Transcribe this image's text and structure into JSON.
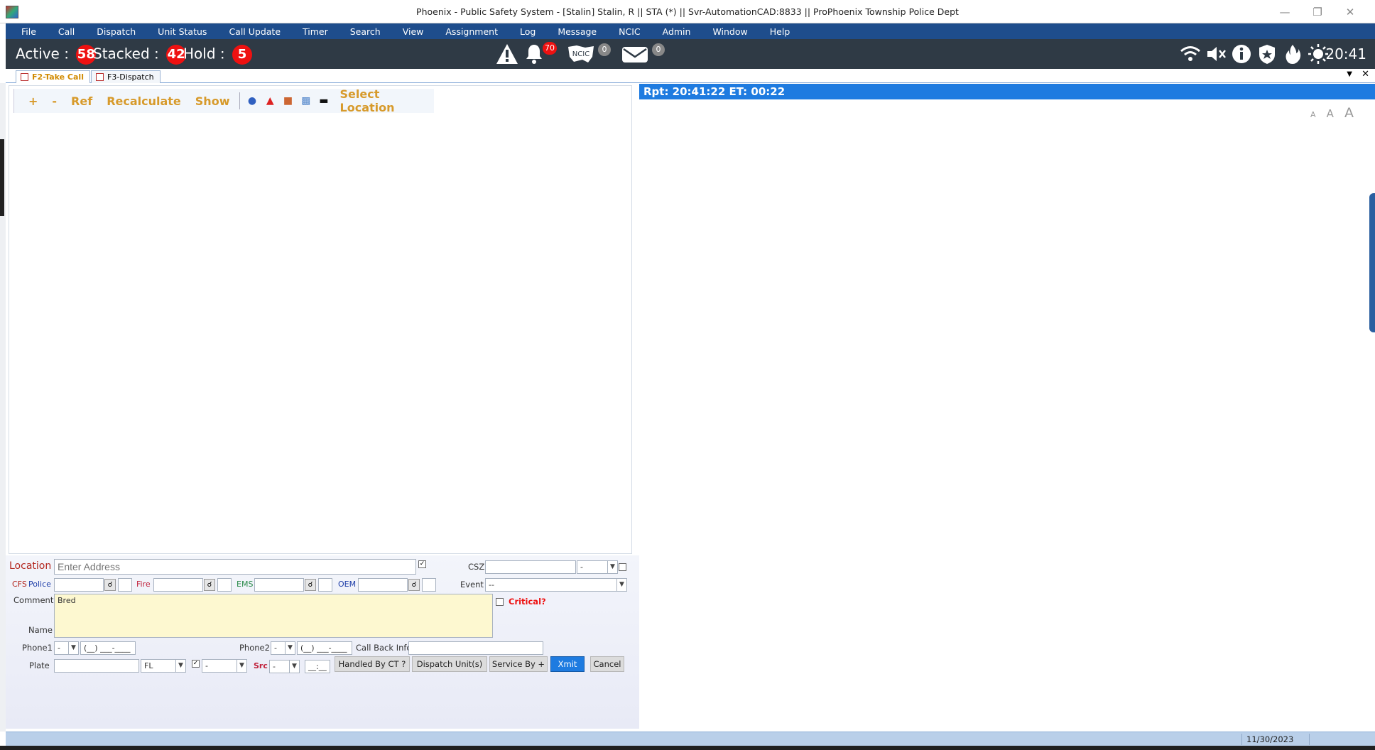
{
  "window": {
    "title": "Phoenix - Public Safety System - [Stalin] Stalin, R || STA (*) || Svr-AutomationCAD:8833 || ProPhoenix Township Police Dept"
  },
  "menu": [
    "File",
    "Call",
    "Dispatch",
    "Unit Status",
    "Call Update",
    "Timer",
    "Search",
    "View",
    "Assignment",
    "Log",
    "Message",
    "NCIC",
    "Admin",
    "Window",
    "Help"
  ],
  "status": {
    "active_label": "Active :",
    "active_count": "58",
    "stacked_label": "Stacked :",
    "stacked_count": "42",
    "hold_label": "Hold :",
    "hold_count": "5",
    "notifications_count": "70",
    "ncic_label": "NCIC",
    "ncic_count": "0",
    "messages_count": "0",
    "clock": "20:41"
  },
  "tabs": [
    "F2-Take Call",
    "F3-Dispatch"
  ],
  "map_toolbar": {
    "plus": "+",
    "minus": "-",
    "ref": "Ref",
    "recalculate": "Recalculate",
    "show": "Show",
    "select_location": "Select Location"
  },
  "report": {
    "header": "Rpt: 20:41:22  ET: 00:22",
    "font_sizes": [
      "A",
      "A",
      "A"
    ]
  },
  "form": {
    "location_label": "Location",
    "location_placeholder": "Enter Address",
    "csz_label": "CSZ",
    "csz_state": "-",
    "cfs_label": "CFS",
    "police_label": "Police",
    "fire_label": "Fire",
    "ems_label": "EMS",
    "oem_label": "OEM",
    "event_label": "Event",
    "event_value": "--",
    "comment_label": "Comment",
    "comment_value": "Bred",
    "critical_label": "Critical?",
    "name_label": "Name",
    "phone1_label": "Phone1",
    "phone1_prefix": "-",
    "phone1_mask": "(__) ___-____",
    "phone2_label": "Phone2",
    "phone2_prefix": "-",
    "phone2_mask": "(__) ___-____",
    "callback_label": "Call Back Info",
    "plate_label": "Plate",
    "plate_state": "FL",
    "plate_type": "-",
    "src_label": "Src",
    "src_value": "-",
    "time_mask": "__:__",
    "btn_handled": "Handled By CT ?",
    "btn_dispatch": "Dispatch Unit(s)",
    "btn_service": "Service By +",
    "btn_xmit": "Xmit",
    "btn_cancel": "Cancel"
  },
  "footer": {
    "date": "11/30/2023"
  },
  "colors": {
    "menubar": "#1e4d8c",
    "statusbar": "#2f3a45",
    "badge_red": "#e11111",
    "accent_orange": "#d79a2b",
    "report_blue": "#1e7be0"
  }
}
